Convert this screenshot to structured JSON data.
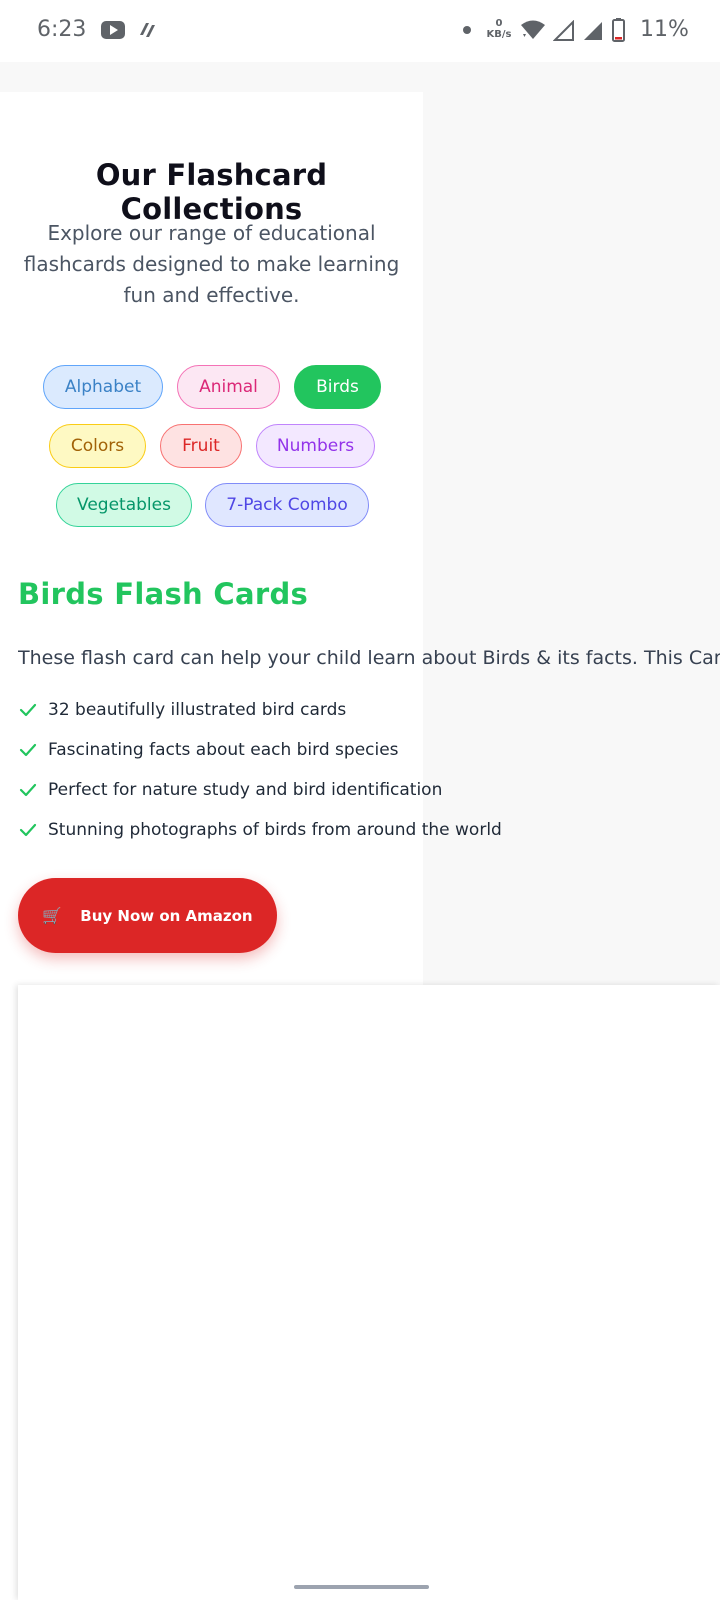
{
  "status_bar": {
    "time": "6:23",
    "net_speed_value": "0",
    "net_speed_unit": "KB/s",
    "battery_percent": "11%",
    "icons": [
      "youtube-icon",
      "app-notification-icon",
      "wifi-icon",
      "signal-icon",
      "battery-icon"
    ]
  },
  "hero": {
    "title": "Our Flashcard Collections",
    "subtitle": "Explore our range of educational flashcards designed to make learning fun and effective."
  },
  "categories": [
    {
      "label": "Alphabet",
      "bg": "#dbeafe",
      "border": "#60a5fa",
      "text": "#3b82c6"
    },
    {
      "label": "Animal",
      "bg": "#fce7f3",
      "border": "#f472b6",
      "text": "#db2777"
    },
    {
      "label": "Birds",
      "bg": "#22c55e",
      "border": "#22c55e",
      "text": "#ffffff",
      "selected": true
    },
    {
      "label": "Colors",
      "bg": "#fef9c3",
      "border": "#facc15",
      "text": "#a16207"
    },
    {
      "label": "Fruit",
      "bg": "#fee2e2",
      "border": "#f87171",
      "text": "#dc2626"
    },
    {
      "label": "Numbers",
      "bg": "#f3e8ff",
      "border": "#c084fc",
      "text": "#9333ea"
    },
    {
      "label": "Vegetables",
      "bg": "#d1fae5",
      "border": "#34d399",
      "text": "#059669"
    },
    {
      "label": "7-Pack Combo",
      "bg": "#e0e7ff",
      "border": "#818cf8",
      "text": "#4f46e5"
    }
  ],
  "section": {
    "title": "Birds Flash Cards",
    "description": "These flash card can help your child learn about Birds & its facts. This Card P",
    "features": [
      "32 beautifully illustrated bird cards",
      "Fascinating facts about each bird species",
      "Perfect for nature study and bird identification",
      "Stunning photographs of birds from around the world"
    ],
    "buy_button": {
      "icon": "🛒",
      "label": "Buy Now on Amazon"
    }
  },
  "colors": {
    "accent_green": "#22c55e",
    "buy_red": "#dc2626"
  }
}
